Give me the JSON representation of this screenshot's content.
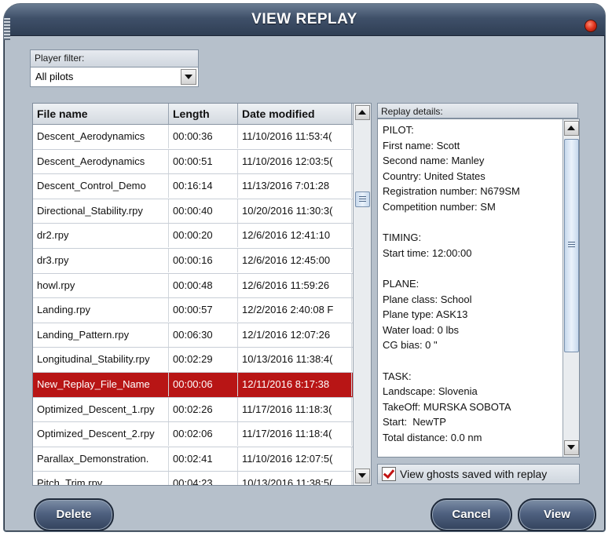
{
  "window": {
    "title": "VIEW REPLAY"
  },
  "filter": {
    "label": "Player filter:",
    "value": "All pilots"
  },
  "table": {
    "columns": [
      "File name",
      "Length",
      "Date modified"
    ],
    "rows": [
      [
        "Descent_Aerodynamics",
        "00:00:36",
        "11/10/2016 11:53:4("
      ],
      [
        "Descent_Aerodynamics",
        "00:00:51",
        "11/10/2016 12:03:5("
      ],
      [
        "Descent_Control_Demo",
        "00:16:14",
        "11/13/2016 7:01:28"
      ],
      [
        "Directional_Stability.rpy",
        "00:00:40",
        "10/20/2016 11:30:3("
      ],
      [
        "dr2.rpy",
        "00:00:20",
        "12/6/2016 12:41:10"
      ],
      [
        "dr3.rpy",
        "00:00:16",
        "12/6/2016 12:45:00"
      ],
      [
        "howl.rpy",
        "00:00:48",
        "12/6/2016 11:59:26"
      ],
      [
        "Landing.rpy",
        "00:00:57",
        "12/2/2016 2:40:08 F"
      ],
      [
        "Landing_Pattern.rpy",
        "00:06:30",
        "12/1/2016 12:07:26"
      ],
      [
        "Longitudinal_Stability.rpy",
        "00:02:29",
        "10/13/2016 11:38:4("
      ],
      [
        "New_Replay_File_Name",
        "00:00:06",
        "12/11/2016 8:17:38"
      ],
      [
        "Optimized_Descent_1.rpy",
        "00:02:26",
        "11/17/2016 11:18:3("
      ],
      [
        "Optimized_Descent_2.rpy",
        "00:02:06",
        "11/17/2016 11:18:4("
      ],
      [
        "Parallax_Demonstration.",
        "00:02:41",
        "11/10/2016 12:07:5("
      ],
      [
        "Pitch_Trim.rpy",
        "00:04:23",
        "10/13/2016 11:38:5("
      ]
    ],
    "selected_index": 10
  },
  "details": {
    "label": "Replay details:",
    "lines": [
      "PILOT:",
      "First name: Scott",
      "Second name: Manley",
      "Country: United States",
      "Registration number: N679SM",
      "Competition number: SM",
      "",
      "TIMING:",
      "Start time: 12:00:00",
      "",
      "PLANE:",
      "Plane class: School",
      "Plane type: ASK13",
      "Water load: 0 lbs",
      "CG bias: 0 \"",
      "",
      "TASK:",
      "Landscape: Slovenia",
      "TakeOff: MURSKA SOBOTA",
      "Start:  NewTP",
      "Total distance: 0.0 nm"
    ]
  },
  "ghosts": {
    "label": "View ghosts saved with replay",
    "checked": true
  },
  "buttons": {
    "delete": "Delete",
    "cancel": "Cancel",
    "view": "View"
  },
  "colors": {
    "titlebar": "#3f5069",
    "selected_row": "#b81515",
    "panel": "#b6c0cb"
  }
}
